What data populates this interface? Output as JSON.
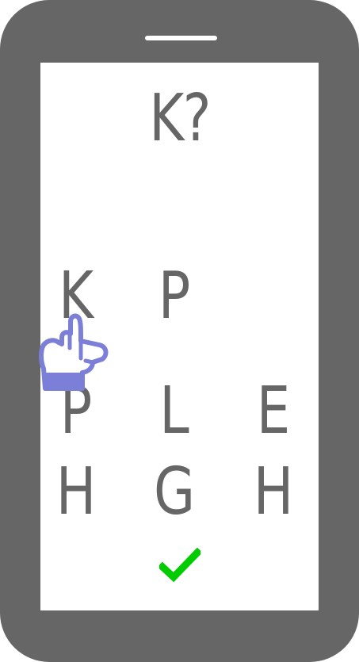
{
  "prompt": "K?",
  "grid": {
    "rows": [
      [
        "K",
        "P",
        ""
      ],
      [
        "P",
        "L",
        "E"
      ],
      [
        "H",
        "G",
        "H"
      ]
    ]
  },
  "icons": {
    "confirm": "checkmark-icon",
    "pointer": "pointing-hand-icon"
  },
  "colors": {
    "device": "#666666",
    "letters": "#666666",
    "confirm": "#00cc00",
    "hand": "#7b7fd8"
  }
}
